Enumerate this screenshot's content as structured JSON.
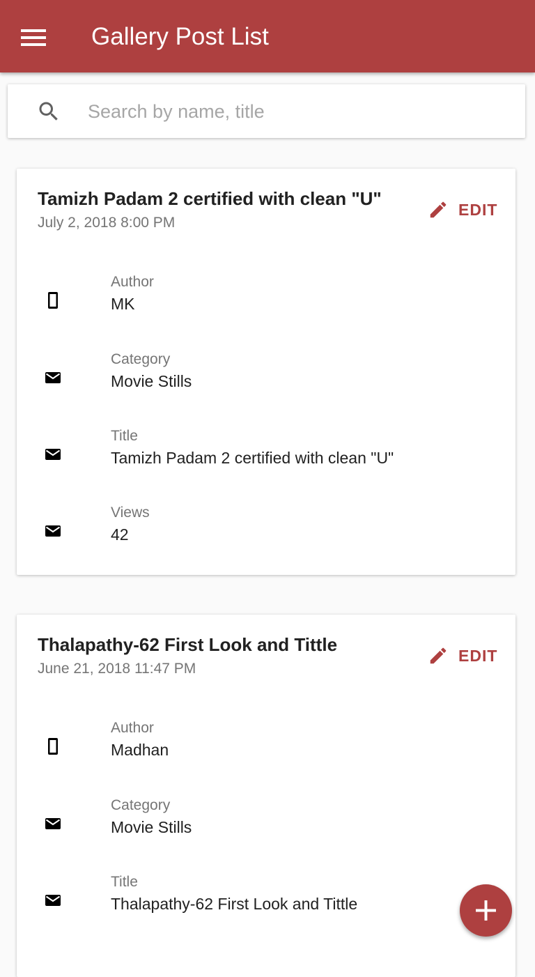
{
  "appbar": {
    "title": "Gallery Post List",
    "menu_icon": "menu-icon",
    "color": "#ae4040"
  },
  "search": {
    "placeholder": "Search by name, title",
    "value": "",
    "icon": "search-icon"
  },
  "edit_label": "EDIT",
  "field_labels": {
    "author": "Author",
    "category": "Category",
    "title": "Title",
    "views": "Views"
  },
  "posts": [
    {
      "title": "Tamizh Padam 2 certified with clean \"U\"",
      "date": "July 2, 2018 8:00 PM",
      "author": "MK",
      "category": "Movie Stills",
      "post_title": "Tamizh Padam 2 certified with clean \"U\"",
      "views": "42"
    },
    {
      "title": "Thalapathy-62 First Look and Tittle",
      "date": "June 21, 2018 11:47 PM",
      "author": "Madhan",
      "category": "Movie Stills",
      "post_title": "Thalapathy-62 First Look and Tittle"
    }
  ],
  "icons": {
    "author": "phone-icon",
    "category": "mail-icon",
    "title": "mail-icon",
    "views": "mail-icon",
    "edit": "pencil-icon",
    "fab": "plus-icon"
  },
  "accent_color": "#ae4040"
}
